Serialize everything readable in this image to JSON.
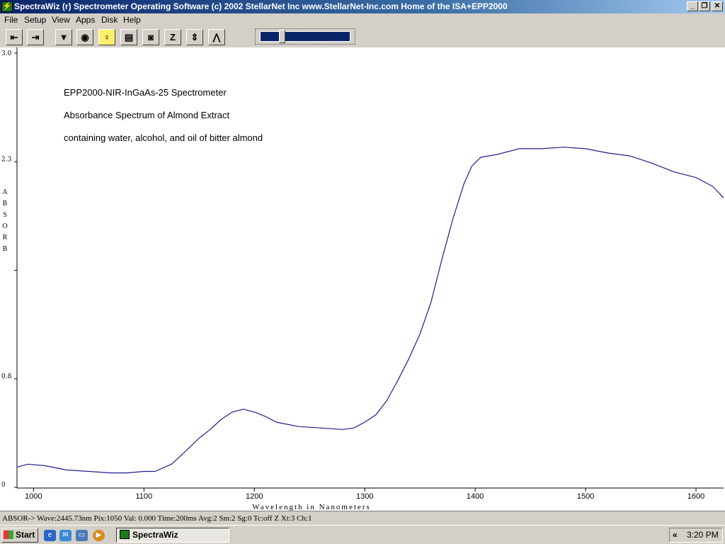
{
  "window": {
    "title": "SpectraWiz (r)  Spectrometer Operating Software (c) 2002 StellarNet Inc  www.StellarNet-Inc.com  Home of the ISA+EPP2000",
    "icon": "spectrawiz-app-icon",
    "controls": [
      "minimize-icon",
      "restore-icon",
      "close-icon"
    ]
  },
  "menu": {
    "items": [
      "File",
      "Setup",
      "View",
      "Apps",
      "Disk",
      "Help"
    ]
  },
  "toolbar": {
    "buttons": [
      {
        "icon": "scroll-left-icon",
        "glyph": "⇤"
      },
      {
        "icon": "scroll-right-icon",
        "glyph": "⇥"
      },
      {
        "icon": "save-spectrum-icon",
        "glyph": "▼"
      },
      {
        "icon": "lamp-icon",
        "glyph": "◉"
      },
      {
        "icon": "bulb-icon",
        "glyph": "♀"
      },
      {
        "icon": "print-icon",
        "glyph": "▤"
      },
      {
        "icon": "camera-icon",
        "glyph": "◙"
      },
      {
        "icon": "zero-icon",
        "glyph": "Z"
      },
      {
        "icon": "scale-icon",
        "glyph": "⇕"
      },
      {
        "icon": "peak-icon",
        "glyph": "⋀"
      }
    ],
    "slider_level": 0.22
  },
  "chart_data": {
    "type": "line",
    "annotations": [
      "EPP2000-NIR-InGaAs-25 Spectrometer",
      "Absorbance Spectrum of Almond Extract",
      "containing water, alcohol, and oil of bitter almond"
    ],
    "xlabel": "Wavelength in Nanometers",
    "ylabel": "ABSORB",
    "xlim": [
      985,
      1625
    ],
    "ylim": [
      0,
      3.0
    ],
    "x_ticks": [
      1000,
      1100,
      1200,
      1300,
      1400,
      1500,
      1600
    ],
    "y_ticks": [
      {
        "v": 0,
        "label": "0"
      },
      {
        "v": 0.75,
        "label": "0.8"
      },
      {
        "v": 1.5,
        "label": ""
      },
      {
        "v": 2.25,
        "label": "2.3"
      },
      {
        "v": 3.0,
        "label": "3.0"
      }
    ],
    "grid": false,
    "line_color": "#1e1e8c",
    "series": [
      {
        "x": [
          985,
          995,
          1010,
          1030,
          1050,
          1070,
          1085,
          1100,
          1110,
          1125,
          1135,
          1150,
          1160,
          1170,
          1180,
          1190,
          1200,
          1210,
          1220,
          1240,
          1260,
          1280,
          1290,
          1300,
          1310,
          1320,
          1330,
          1340,
          1350,
          1360,
          1370,
          1380,
          1390,
          1397,
          1405,
          1420,
          1440,
          1460,
          1480,
          1500,
          1520,
          1540,
          1560,
          1580,
          1600,
          1615,
          1625
        ],
        "y": [
          0.14,
          0.16,
          0.15,
          0.12,
          0.11,
          0.1,
          0.1,
          0.11,
          0.11,
          0.16,
          0.23,
          0.34,
          0.4,
          0.47,
          0.52,
          0.54,
          0.52,
          0.49,
          0.45,
          0.42,
          0.41,
          0.4,
          0.41,
          0.45,
          0.5,
          0.6,
          0.74,
          0.89,
          1.06,
          1.28,
          1.58,
          1.86,
          2.1,
          2.22,
          2.28,
          2.3,
          2.34,
          2.34,
          2.35,
          2.34,
          2.31,
          2.29,
          2.24,
          2.18,
          2.14,
          2.08,
          2.0
        ]
      }
    ]
  },
  "status": {
    "text": "ABSOR->  Wave:2445.73nm  Pix:1050  Val:  0.000  Time:200ms  Avg:2  Sm:2  Sg:0  Tc:off  Z  Xt:3  Ch:1"
  },
  "taskbar": {
    "start_label": "Start",
    "quicklaunch": [
      {
        "icon": "internet-explorer-icon",
        "glyph": "e",
        "color": "#2a64c8"
      },
      {
        "icon": "outlook-express-icon",
        "glyph": "✉",
        "color": "#3a8ad8"
      },
      {
        "icon": "show-desktop-icon",
        "glyph": "▭",
        "color": "#4a7ab8"
      },
      {
        "icon": "media-player-icon",
        "glyph": "▶",
        "color": "#d88a20"
      }
    ],
    "task_label": "SpectraWiz",
    "tray_chevron": "«",
    "clock": "3:20 PM"
  }
}
